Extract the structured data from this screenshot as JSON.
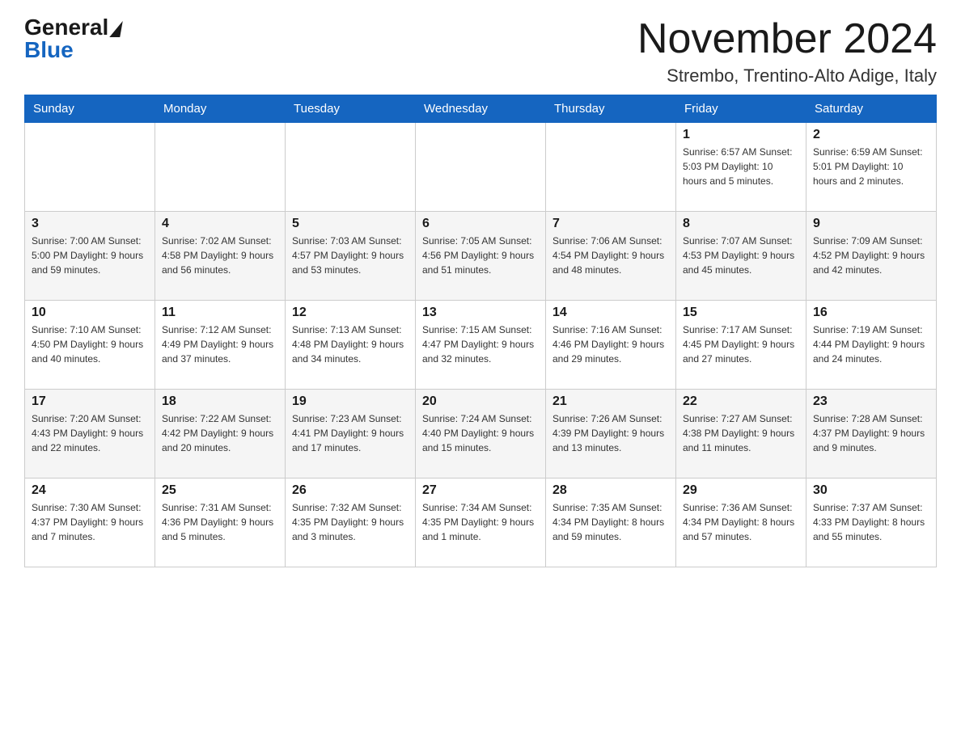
{
  "header": {
    "logo_general": "General",
    "logo_blue": "Blue",
    "month_title": "November 2024",
    "location": "Strembo, Trentino-Alto Adige, Italy"
  },
  "weekdays": [
    "Sunday",
    "Monday",
    "Tuesday",
    "Wednesday",
    "Thursday",
    "Friday",
    "Saturday"
  ],
  "weeks": [
    {
      "days": [
        {
          "number": "",
          "info": ""
        },
        {
          "number": "",
          "info": ""
        },
        {
          "number": "",
          "info": ""
        },
        {
          "number": "",
          "info": ""
        },
        {
          "number": "",
          "info": ""
        },
        {
          "number": "1",
          "info": "Sunrise: 6:57 AM\nSunset: 5:03 PM\nDaylight: 10 hours and 5 minutes."
        },
        {
          "number": "2",
          "info": "Sunrise: 6:59 AM\nSunset: 5:01 PM\nDaylight: 10 hours and 2 minutes."
        }
      ]
    },
    {
      "days": [
        {
          "number": "3",
          "info": "Sunrise: 7:00 AM\nSunset: 5:00 PM\nDaylight: 9 hours and 59 minutes."
        },
        {
          "number": "4",
          "info": "Sunrise: 7:02 AM\nSunset: 4:58 PM\nDaylight: 9 hours and 56 minutes."
        },
        {
          "number": "5",
          "info": "Sunrise: 7:03 AM\nSunset: 4:57 PM\nDaylight: 9 hours and 53 minutes."
        },
        {
          "number": "6",
          "info": "Sunrise: 7:05 AM\nSunset: 4:56 PM\nDaylight: 9 hours and 51 minutes."
        },
        {
          "number": "7",
          "info": "Sunrise: 7:06 AM\nSunset: 4:54 PM\nDaylight: 9 hours and 48 minutes."
        },
        {
          "number": "8",
          "info": "Sunrise: 7:07 AM\nSunset: 4:53 PM\nDaylight: 9 hours and 45 minutes."
        },
        {
          "number": "9",
          "info": "Sunrise: 7:09 AM\nSunset: 4:52 PM\nDaylight: 9 hours and 42 minutes."
        }
      ]
    },
    {
      "days": [
        {
          "number": "10",
          "info": "Sunrise: 7:10 AM\nSunset: 4:50 PM\nDaylight: 9 hours and 40 minutes."
        },
        {
          "number": "11",
          "info": "Sunrise: 7:12 AM\nSunset: 4:49 PM\nDaylight: 9 hours and 37 minutes."
        },
        {
          "number": "12",
          "info": "Sunrise: 7:13 AM\nSunset: 4:48 PM\nDaylight: 9 hours and 34 minutes."
        },
        {
          "number": "13",
          "info": "Sunrise: 7:15 AM\nSunset: 4:47 PM\nDaylight: 9 hours and 32 minutes."
        },
        {
          "number": "14",
          "info": "Sunrise: 7:16 AM\nSunset: 4:46 PM\nDaylight: 9 hours and 29 minutes."
        },
        {
          "number": "15",
          "info": "Sunrise: 7:17 AM\nSunset: 4:45 PM\nDaylight: 9 hours and 27 minutes."
        },
        {
          "number": "16",
          "info": "Sunrise: 7:19 AM\nSunset: 4:44 PM\nDaylight: 9 hours and 24 minutes."
        }
      ]
    },
    {
      "days": [
        {
          "number": "17",
          "info": "Sunrise: 7:20 AM\nSunset: 4:43 PM\nDaylight: 9 hours and 22 minutes."
        },
        {
          "number": "18",
          "info": "Sunrise: 7:22 AM\nSunset: 4:42 PM\nDaylight: 9 hours and 20 minutes."
        },
        {
          "number": "19",
          "info": "Sunrise: 7:23 AM\nSunset: 4:41 PM\nDaylight: 9 hours and 17 minutes."
        },
        {
          "number": "20",
          "info": "Sunrise: 7:24 AM\nSunset: 4:40 PM\nDaylight: 9 hours and 15 minutes."
        },
        {
          "number": "21",
          "info": "Sunrise: 7:26 AM\nSunset: 4:39 PM\nDaylight: 9 hours and 13 minutes."
        },
        {
          "number": "22",
          "info": "Sunrise: 7:27 AM\nSunset: 4:38 PM\nDaylight: 9 hours and 11 minutes."
        },
        {
          "number": "23",
          "info": "Sunrise: 7:28 AM\nSunset: 4:37 PM\nDaylight: 9 hours and 9 minutes."
        }
      ]
    },
    {
      "days": [
        {
          "number": "24",
          "info": "Sunrise: 7:30 AM\nSunset: 4:37 PM\nDaylight: 9 hours and 7 minutes."
        },
        {
          "number": "25",
          "info": "Sunrise: 7:31 AM\nSunset: 4:36 PM\nDaylight: 9 hours and 5 minutes."
        },
        {
          "number": "26",
          "info": "Sunrise: 7:32 AM\nSunset: 4:35 PM\nDaylight: 9 hours and 3 minutes."
        },
        {
          "number": "27",
          "info": "Sunrise: 7:34 AM\nSunset: 4:35 PM\nDaylight: 9 hours and 1 minute."
        },
        {
          "number": "28",
          "info": "Sunrise: 7:35 AM\nSunset: 4:34 PM\nDaylight: 8 hours and 59 minutes."
        },
        {
          "number": "29",
          "info": "Sunrise: 7:36 AM\nSunset: 4:34 PM\nDaylight: 8 hours and 57 minutes."
        },
        {
          "number": "30",
          "info": "Sunrise: 7:37 AM\nSunset: 4:33 PM\nDaylight: 8 hours and 55 minutes."
        }
      ]
    }
  ]
}
